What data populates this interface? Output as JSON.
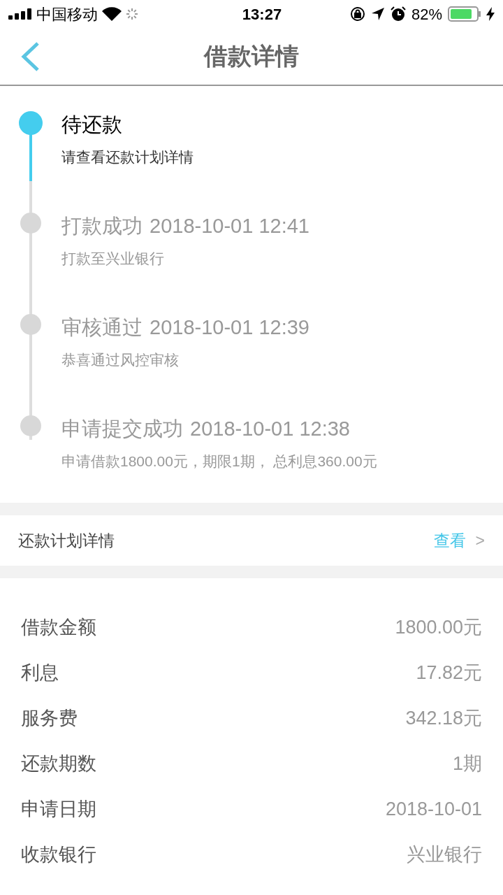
{
  "status_bar": {
    "carrier": "中国移动",
    "time": "13:27",
    "battery_text": "82%",
    "battery": {
      "level": 0.82
    }
  },
  "nav": {
    "title": "借款详情"
  },
  "timeline": [
    {
      "title": "待还款",
      "desc": "请查看还款计划详情",
      "current": true
    },
    {
      "title": "打款成功",
      "time": "2018-10-01 12:41",
      "desc": "打款至兴业银行",
      "current": false
    },
    {
      "title": "审核通过",
      "time": "2018-10-01 12:39",
      "desc": "恭喜通过风控审核",
      "current": false
    },
    {
      "title": "申请提交成功",
      "time": "2018-10-01 12:38",
      "desc": "申请借款1800.00元，期限1期， 总利息360.00元",
      "current": false
    }
  ],
  "plan_row": {
    "label": "还款计划详情",
    "action": "查看",
    "chevron": ">"
  },
  "details": [
    {
      "label": "借款金额",
      "value": "1800.00元"
    },
    {
      "label": "利息",
      "value": "17.82元"
    },
    {
      "label": "服务费",
      "value": "342.18元"
    },
    {
      "label": "还款期数",
      "value": "1期"
    },
    {
      "label": "申请日期",
      "value": "2018-10-01"
    },
    {
      "label": "收款银行",
      "value": "兴业银行"
    }
  ]
}
